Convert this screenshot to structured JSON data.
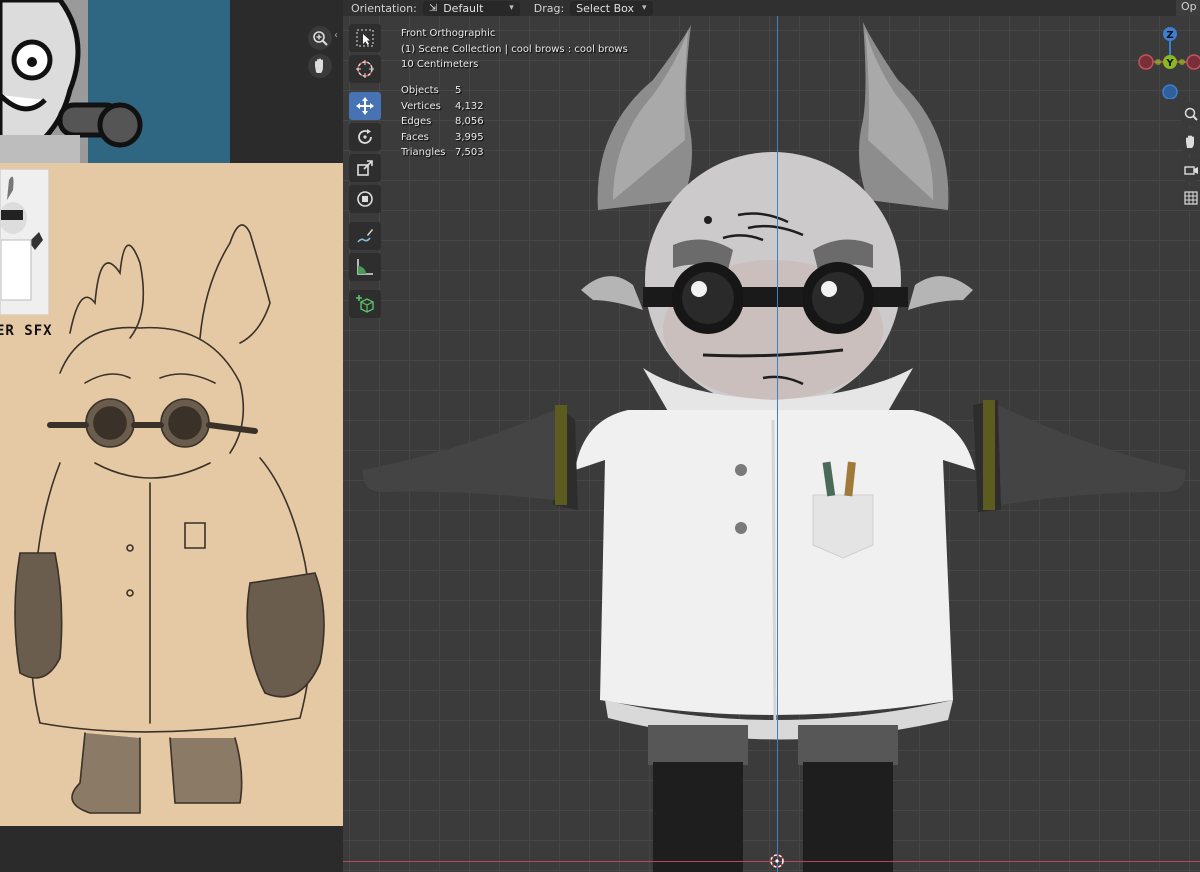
{
  "header": {
    "orientation_label": "Orientation:",
    "orientation_value": "Default",
    "drag_label": "Drag:",
    "drag_value": "Select Box",
    "options_label": "Op"
  },
  "viewport_info": {
    "view_name": "Front Orthographic",
    "collection": "(1) Scene Collection | cool brows : cool brows",
    "scale": "10 Centimeters"
  },
  "stats": [
    {
      "label": "Objects",
      "value": "5"
    },
    {
      "label": "Vertices",
      "value": "4,132"
    },
    {
      "label": "Edges",
      "value": "8,056"
    },
    {
      "label": "Faces",
      "value": "3,995"
    },
    {
      "label": "Triangles",
      "value": "7,503"
    }
  ],
  "reference": {
    "sfx_text": "ER SFX"
  },
  "gizmo": {
    "z": "Z",
    "y": "Y",
    "x": "X"
  },
  "colors": {
    "active_tool": "#4772b3",
    "z_axis": "#3d7fd0",
    "x_axis": "#b64a57",
    "y_axis": "#8cb81f",
    "sketch_bg": "#e4c9a4",
    "ref_bg": "#2f6682"
  },
  "tools": [
    {
      "name": "select-box-icon",
      "active": false
    },
    {
      "name": "cursor-icon",
      "active": false
    },
    {
      "name": "move-icon",
      "active": true
    },
    {
      "name": "rotate-icon",
      "active": false
    },
    {
      "name": "scale-icon",
      "active": false
    },
    {
      "name": "transform-icon",
      "active": false
    },
    {
      "name": "annotate-icon",
      "active": false
    },
    {
      "name": "measure-icon",
      "active": false
    },
    {
      "name": "add-cube-icon",
      "active": false
    }
  ]
}
